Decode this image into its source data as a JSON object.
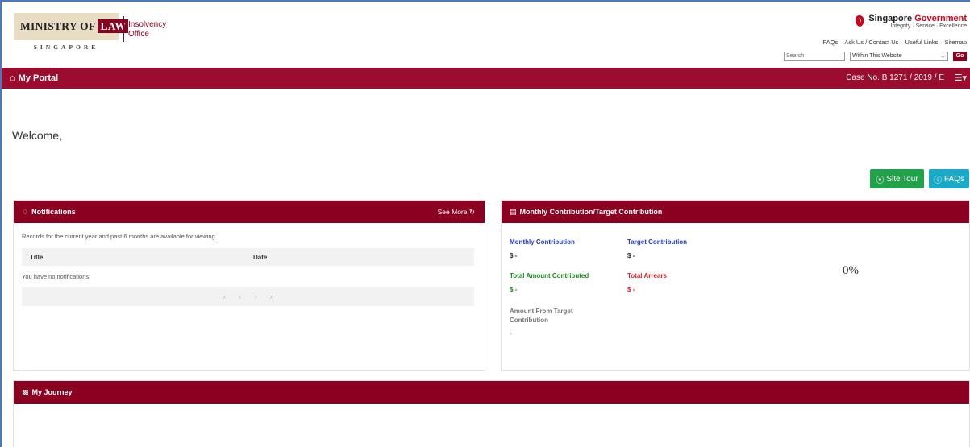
{
  "header": {
    "logo": {
      "line": "MINISTRY OF",
      "law": "LAW",
      "sub": "SINGAPORE",
      "office": "Insolvency Office"
    },
    "sgov": {
      "title_a": "Singapore",
      "title_b": "Government",
      "tagline": "Integrity · Service · Excellence"
    },
    "links": [
      "FAQs",
      "Ask Us / Contact Us",
      "Useful Links",
      "Sitemap"
    ],
    "search": {
      "placeholder": "Search",
      "scope": "Within This Website",
      "go": "Go"
    }
  },
  "portal_bar": {
    "title": "My Portal",
    "case_no": "Case No. B 1271 / 2019 / E"
  },
  "welcome": "Welcome,",
  "buttons": {
    "site_tour": "Site Tour",
    "faqs": "FAQs"
  },
  "notifications": {
    "title": "Notifications",
    "see_more": "See More",
    "note": "Records for the current year and past 6 months are available for viewing.",
    "columns": [
      "Title",
      "Date"
    ],
    "empty": "You have no notifications.",
    "pager": [
      "«",
      "‹",
      "›",
      "»"
    ]
  },
  "monthly": {
    "title": "Monthly Contribution/Target Contribution",
    "monthly_contribution": {
      "label": "Monthly Contribution",
      "value": "$ -"
    },
    "target_contribution": {
      "label": "Target Contribution",
      "value": "$ -"
    },
    "total_contributed": {
      "label": "Total Amount Contributed",
      "value": "$ -"
    },
    "total_arrears": {
      "label": "Total Arrears",
      "value": "$ -"
    },
    "amount_from_target": {
      "label": "Amount From Target Contribution",
      "value": "-"
    },
    "percent": "0%"
  },
  "journey": {
    "title": "My Journey"
  },
  "colors": {
    "brand": "#8b0020",
    "tour": "#21a14a",
    "faq": "#1aa9c7"
  }
}
